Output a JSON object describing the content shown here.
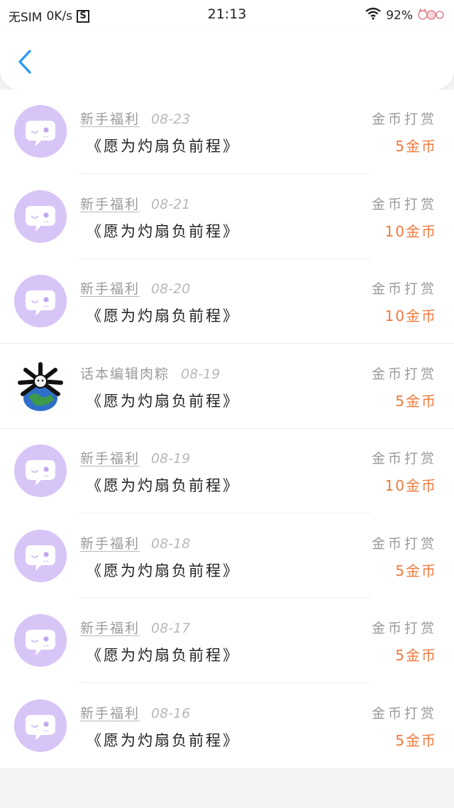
{
  "status_bar": {
    "carrier": "无SIM",
    "speed": "0K/s",
    "s_icon": "S",
    "time": "21:13",
    "battery": "92%",
    "icons": [
      "wifi-icon",
      "battery-cat-icon"
    ]
  },
  "navbar": {
    "back_icon": "chevron-left-icon",
    "accent": "#2b9af3"
  },
  "colors": {
    "amount": "#f07a3c",
    "avatar_bg": "#d8c5f7",
    "meta_text": "#9a9a9a"
  },
  "rewards": [
    {
      "sender": "新手福利",
      "date": "08-23",
      "type": "金币打赏",
      "book": "《愿为灼扇负前程》",
      "amount": "5金币",
      "avatar": "chat-bubble-avatar"
    },
    {
      "sender": "新手福利",
      "date": "08-21",
      "type": "金币打赏",
      "book": "《愿为灼扇负前程》",
      "amount": "10金币",
      "avatar": "chat-bubble-avatar"
    },
    {
      "sender": "新手福利",
      "date": "08-20",
      "type": "金币打赏",
      "book": "《愿为灼扇负前程》",
      "amount": "10金币",
      "avatar": "chat-bubble-avatar"
    },
    {
      "sender": "话本编辑肉粽",
      "date": "08-19",
      "type": "金币打赏",
      "book": "《愿为灼扇负前程》",
      "amount": "5金币",
      "avatar": "earth-bones-avatar"
    },
    {
      "sender": "新手福利",
      "date": "08-19",
      "type": "金币打赏",
      "book": "《愿为灼扇负前程》",
      "amount": "10金币",
      "avatar": "chat-bubble-avatar"
    },
    {
      "sender": "新手福利",
      "date": "08-18",
      "type": "金币打赏",
      "book": "《愿为灼扇负前程》",
      "amount": "5金币",
      "avatar": "chat-bubble-avatar"
    },
    {
      "sender": "新手福利",
      "date": "08-17",
      "type": "金币打赏",
      "book": "《愿为灼扇负前程》",
      "amount": "5金币",
      "avatar": "chat-bubble-avatar"
    },
    {
      "sender": "新手福利",
      "date": "08-16",
      "type": "金币打赏",
      "book": "《愿为灼扇负前程》",
      "amount": "5金币",
      "avatar": "chat-bubble-avatar"
    }
  ]
}
